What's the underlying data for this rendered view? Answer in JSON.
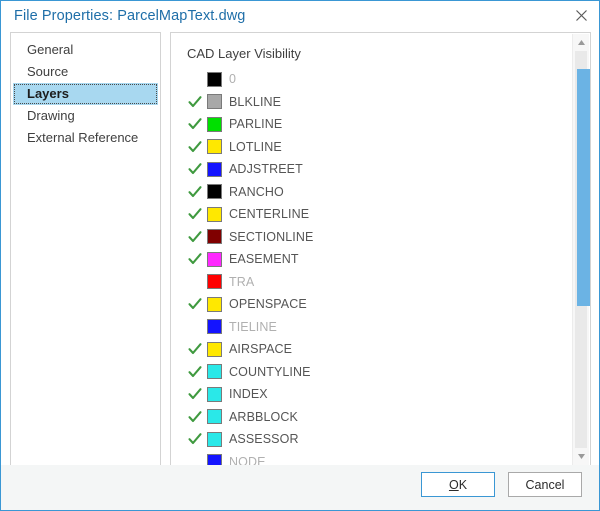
{
  "window": {
    "title": "File Properties: ParcelMapText.dwg",
    "close_icon": "close-icon",
    "border_color": "#3a97d4",
    "title_color": "#1e6ea8"
  },
  "sidebar": {
    "items": [
      {
        "label": "General",
        "selected": false
      },
      {
        "label": "Source",
        "selected": false
      },
      {
        "label": "Layers",
        "selected": true
      },
      {
        "label": "Drawing",
        "selected": false
      },
      {
        "label": "External Reference",
        "selected": false
      }
    ],
    "selected_background": "#a8d8f0"
  },
  "main": {
    "heading": "CAD Layer Visibility",
    "check_icon": "check-icon",
    "check_color": "#3f9a3f",
    "layers": [
      {
        "name": "0",
        "color": "#000000",
        "visible": false
      },
      {
        "name": "BLKLINE",
        "color": "#a8a8a8",
        "visible": true
      },
      {
        "name": "PARLINE",
        "color": "#00e000",
        "visible": true
      },
      {
        "name": "LOTLINE",
        "color": "#ffe800",
        "visible": true
      },
      {
        "name": "ADJSTREET",
        "color": "#1414ff",
        "visible": true
      },
      {
        "name": "RANCHO",
        "color": "#000000",
        "visible": true
      },
      {
        "name": "CENTERLINE",
        "color": "#ffe800",
        "visible": true
      },
      {
        "name": "SECTIONLINE",
        "color": "#800000",
        "visible": true
      },
      {
        "name": "EASEMENT",
        "color": "#ff28ff",
        "visible": true
      },
      {
        "name": "TRA",
        "color": "#ff0000",
        "visible": false
      },
      {
        "name": "OPENSPACE",
        "color": "#ffe800",
        "visible": true
      },
      {
        "name": "TIELINE",
        "color": "#1414ff",
        "visible": false
      },
      {
        "name": "AIRSPACE",
        "color": "#ffe800",
        "visible": true
      },
      {
        "name": "COUNTYLINE",
        "color": "#2ae8e8",
        "visible": true
      },
      {
        "name": "INDEX",
        "color": "#2ae8e8",
        "visible": true
      },
      {
        "name": "ARBBLOCK",
        "color": "#2ae8e8",
        "visible": true
      },
      {
        "name": "ASSESSOR",
        "color": "#2ae8e8",
        "visible": true
      },
      {
        "name": "NODE",
        "color": "#1414ff",
        "visible": false
      }
    ],
    "scrollbar": {
      "up_arrow_icon": "triangle-up-icon",
      "down_arrow_icon": "triangle-down-icon",
      "thumb_color": "#6bb3e4"
    }
  },
  "footer": {
    "ok_label": "OK",
    "ok_mnemonic": "O",
    "ok_rest": "K",
    "cancel_label": "Cancel"
  }
}
